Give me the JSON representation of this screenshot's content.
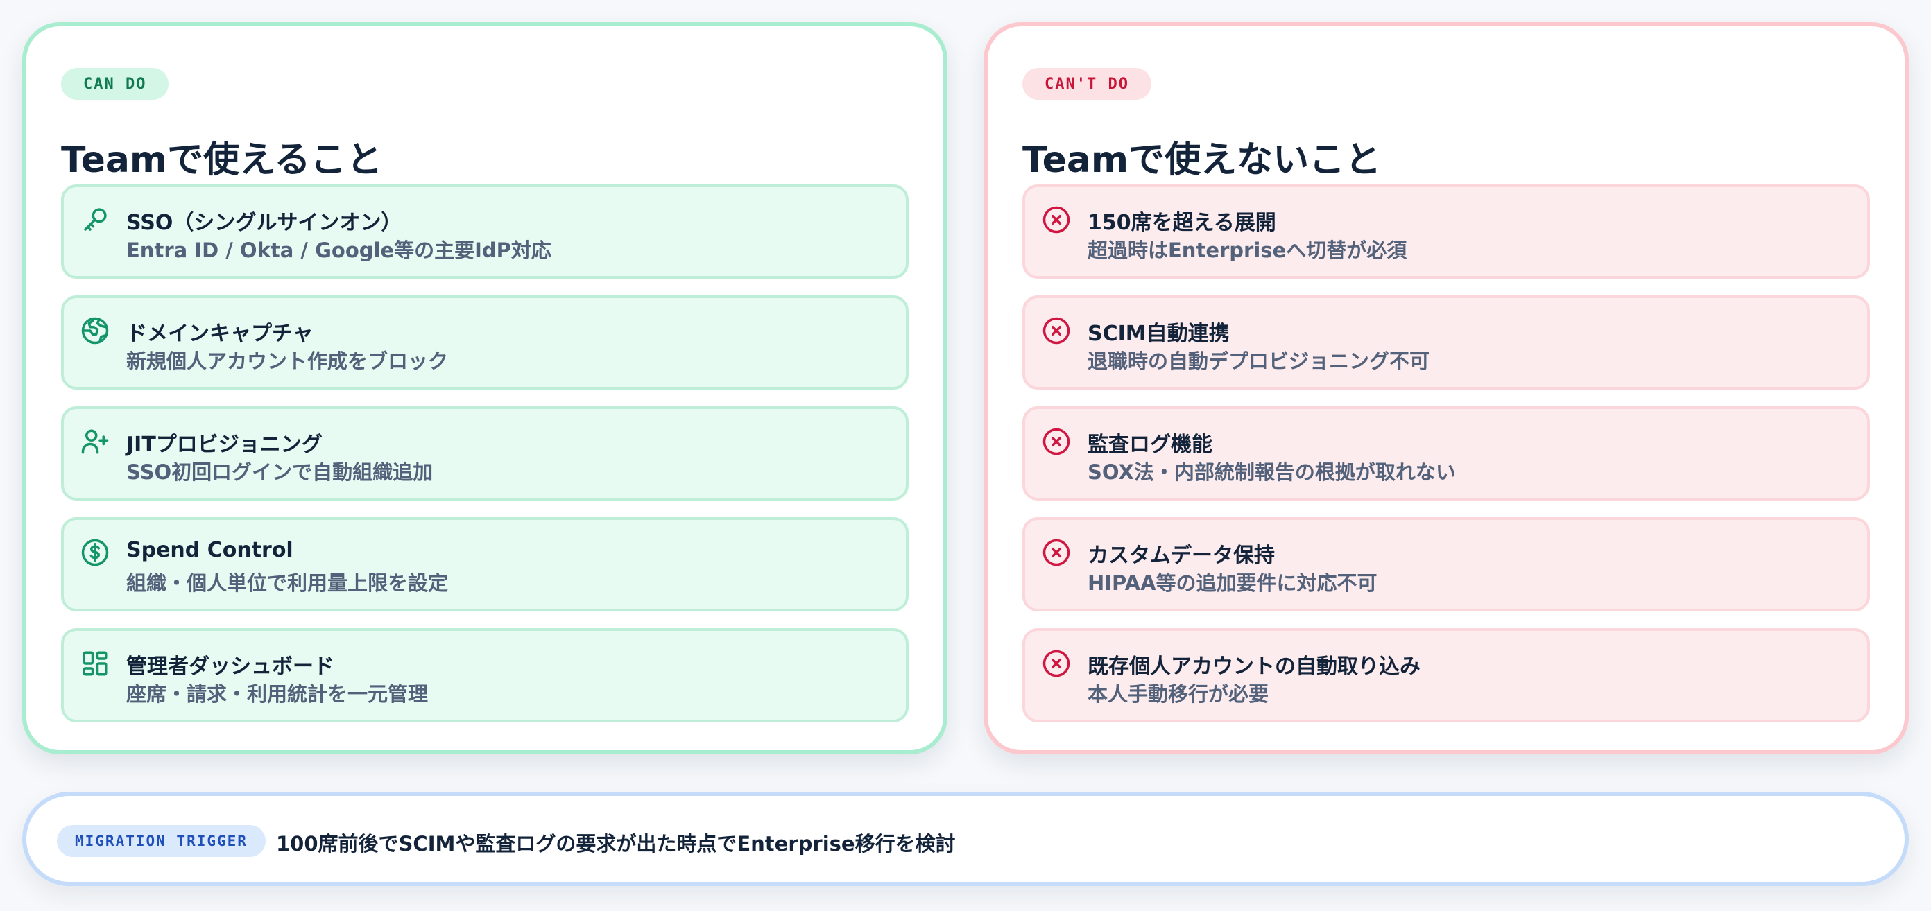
{
  "can": {
    "badge": "CAN DO",
    "title": "Teamで使えること",
    "items": [
      {
        "icon": "key-icon",
        "label": "SSO（シングルサインオン）",
        "sub": "Entra ID / Okta / Google等の主要IdP対応"
      },
      {
        "icon": "globe-icon",
        "label": "ドメインキャプチャ",
        "sub": "新規個人アカウント作成をブロック"
      },
      {
        "icon": "user-plus-icon",
        "label": "JITプロビジョニング",
        "sub": "SSO初回ログインで自動組織追加"
      },
      {
        "icon": "dollar-circle-icon",
        "label": "Spend Control",
        "sub": "組織・個人単位で利用量上限を設定"
      },
      {
        "icon": "dashboard-icon",
        "label": "管理者ダッシュボード",
        "sub": "座席・請求・利用統計を一元管理"
      }
    ]
  },
  "cant": {
    "badge": "CAN'T DO",
    "title": "Teamで使えないこと",
    "items": [
      {
        "icon": "x-circle-icon",
        "label": "150席を超える展開",
        "sub": "超過時はEnterpriseへ切替が必須"
      },
      {
        "icon": "x-circle-icon",
        "label": "SCIM自動連携",
        "sub": "退職時の自動デプロビジョニング不可"
      },
      {
        "icon": "x-circle-icon",
        "label": "監査ログ機能",
        "sub": "SOX法・内部統制報告の根拠が取れない"
      },
      {
        "icon": "x-circle-icon",
        "label": "カスタムデータ保持",
        "sub": "HIPAA等の追加要件に対応不可"
      },
      {
        "icon": "x-circle-icon",
        "label": "既存個人アカウントの自動取り込み",
        "sub": "本人手動移行が必要"
      }
    ]
  },
  "trigger": {
    "badge": "MIGRATION TRIGGER",
    "text": "100席前後でSCIMや監査ログの要求が出た時点でEnterprise移行を検討"
  },
  "colors": {
    "can_accent": "#14946a",
    "cant_accent": "#cf1742",
    "trigger_accent": "#1f4fb8"
  }
}
